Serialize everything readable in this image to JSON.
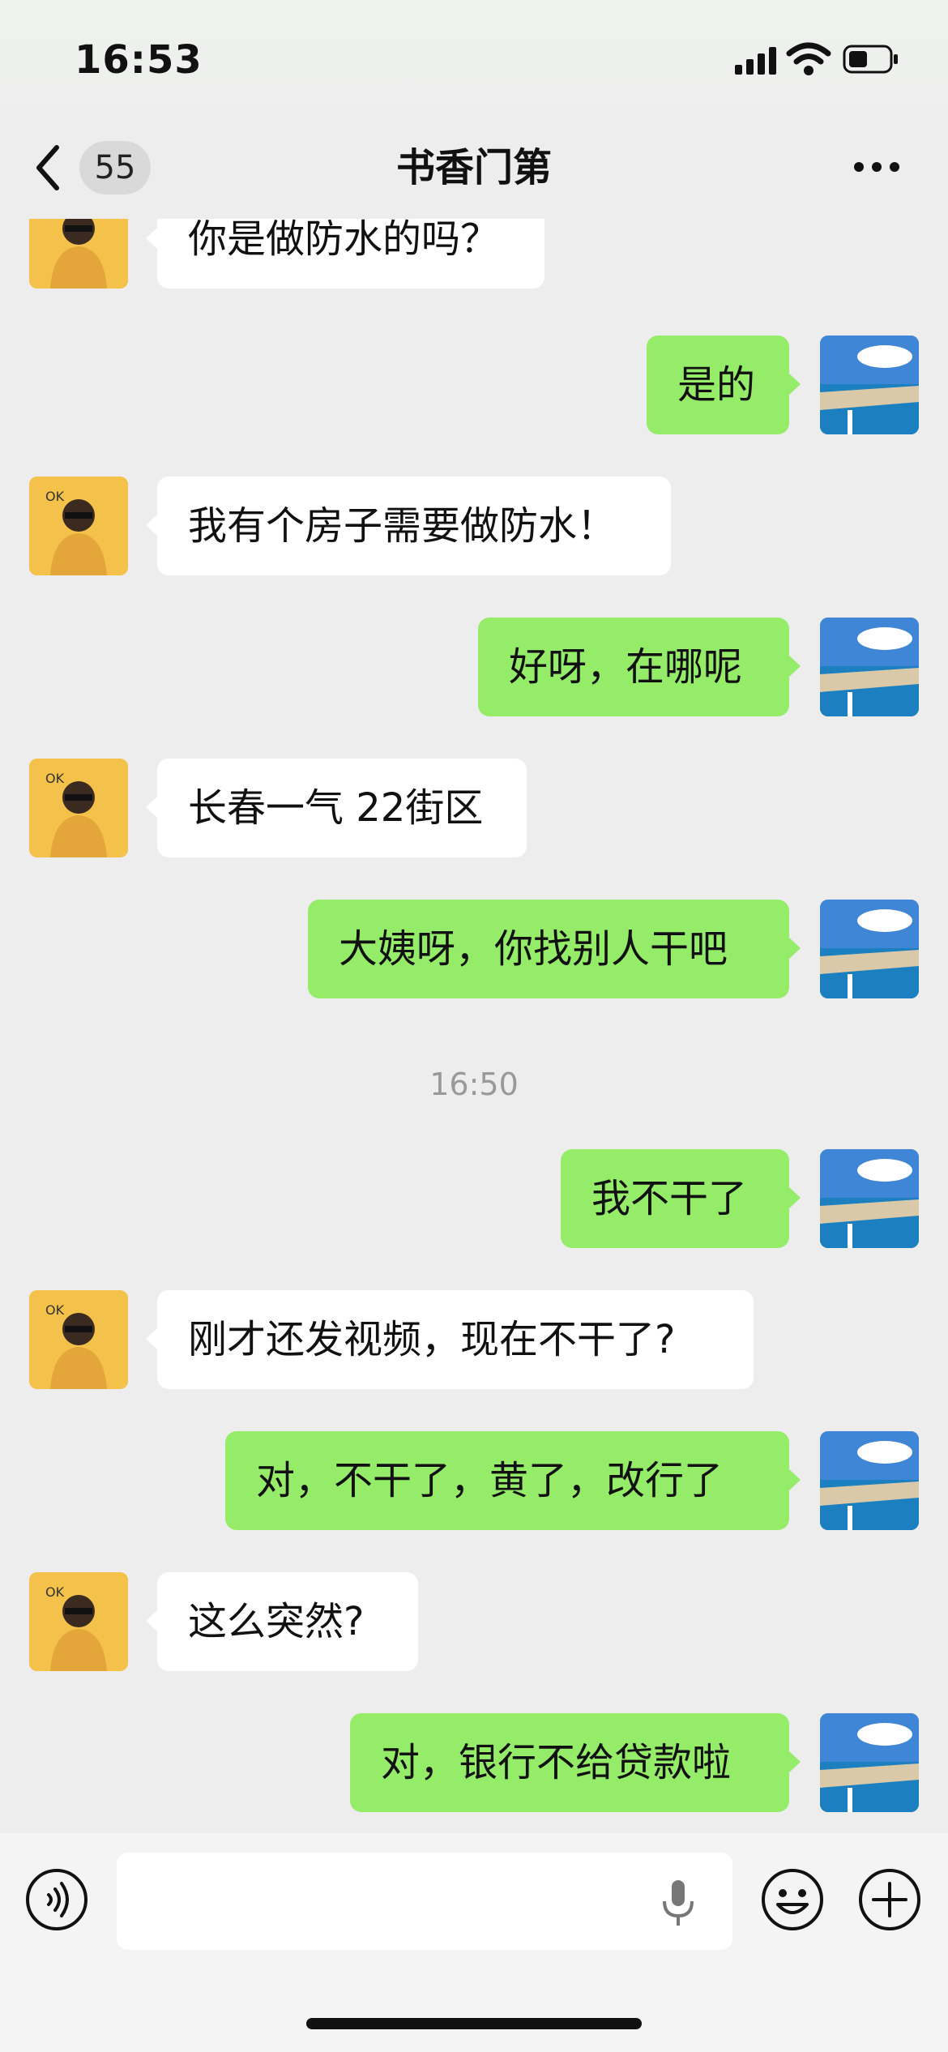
{
  "status_bar": {
    "time": "16:53"
  },
  "header": {
    "back_badge": "55",
    "title": "书香门第"
  },
  "messages": [
    {
      "side": "left",
      "text": "你是做防水的吗？"
    },
    {
      "side": "right",
      "text": "是的"
    },
    {
      "side": "left",
      "text": "我有个房子需要做防水！"
    },
    {
      "side": "right",
      "text": "好呀，在哪呢"
    },
    {
      "side": "left",
      "text": "长春一气 22街区"
    },
    {
      "side": "right",
      "text": "大姨呀，你找别人干吧"
    },
    {
      "side": "right",
      "text": "我不干了"
    },
    {
      "side": "left",
      "text": "刚才还发视频，现在不干了?"
    },
    {
      "side": "right",
      "text": "对，不干了，黄了，改行了"
    },
    {
      "side": "left",
      "text": "这么突然?"
    },
    {
      "side": "right",
      "text": "对，银行不给贷款啦"
    }
  ],
  "timestamp": "16:50",
  "colors": {
    "accent_green": "#95ec69",
    "background": "#ededed"
  },
  "icons": [
    "back-chevron-icon",
    "more-icon",
    "voice-icon",
    "mic-icon",
    "emoji-icon",
    "plus-icon"
  ]
}
